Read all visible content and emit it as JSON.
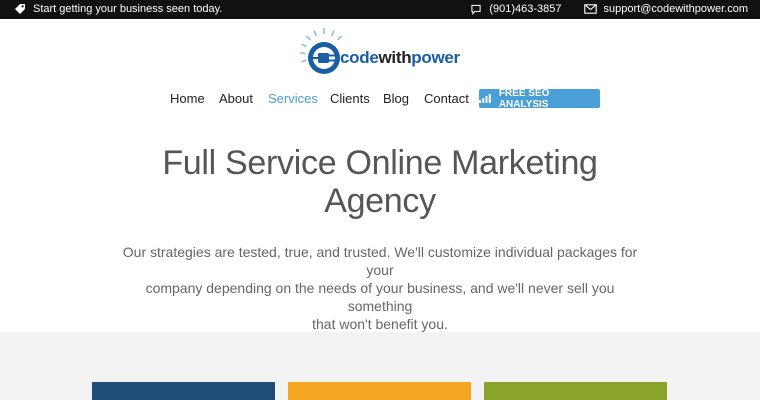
{
  "topbar": {
    "tagline": "Start getting your business seen today.",
    "phone": "(901)463-3857",
    "email": "support@codewithpower.com"
  },
  "logo": {
    "word_1": "code",
    "word_2": "with",
    "word_3": "power"
  },
  "nav": {
    "items": [
      {
        "label": "Home"
      },
      {
        "label": "About"
      },
      {
        "label": "Services"
      },
      {
        "label": "Clients"
      },
      {
        "label": "Blog"
      },
      {
        "label": "Contact"
      }
    ],
    "active": "Services",
    "cta_label": "FREE SEO ANALYSIS"
  },
  "hero": {
    "title_line_1": "Full Service Online Marketing",
    "title_line_2": "Agency",
    "text_line_1": "Our strategies are tested, true, and trusted. We'll customize individual packages for your",
    "text_line_2": "company depending on the needs of your business, and we'll never sell you something",
    "text_line_3": "that won't benefit you."
  },
  "colors": {
    "accent": "#4a9fd8",
    "topbar": "#111111",
    "card_1": "#1f4f78",
    "card_2": "#f5a623",
    "card_3": "#8aa32a"
  }
}
